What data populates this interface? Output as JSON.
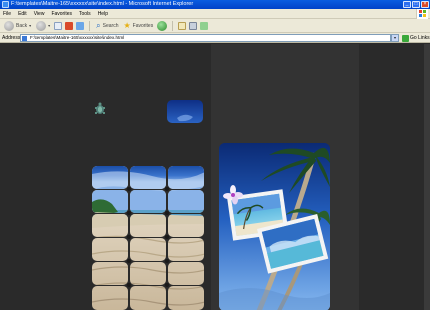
{
  "window": {
    "title": "F:\\templates\\Maitre-165\\xxxxxx\\site\\index.html - Microsoft Internet Explorer",
    "buttons": [
      "_",
      "□",
      "×"
    ]
  },
  "menu": {
    "items": [
      "File",
      "Edit",
      "View",
      "Favorites",
      "Tools",
      "Help"
    ]
  },
  "toolbar": {
    "back_label": "Back",
    "search_label": "Search",
    "favorites_label": "Favorites"
  },
  "address": {
    "label": "Address",
    "value": "F:\\templates\\Maitre-165\\xxxxxx\\site\\index.html",
    "go_label": "Go",
    "links_label": "Links"
  },
  "colors": {
    "page_background": "#2a2a2a",
    "side_strip": "#333333",
    "xp_title_blue": "#0a5ce0"
  }
}
